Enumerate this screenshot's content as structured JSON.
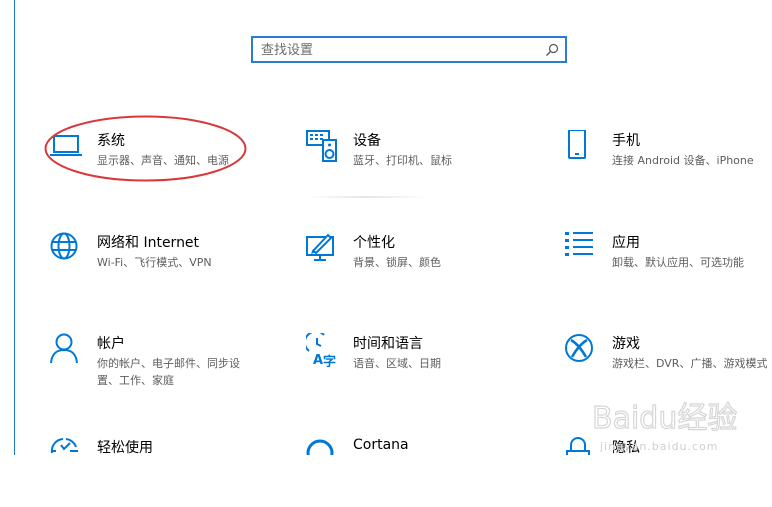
{
  "search": {
    "placeholder": "查找设置"
  },
  "tiles": [
    {
      "title": "系统",
      "desc": "显示器、声音、通知、电源",
      "icon": "laptop-icon"
    },
    {
      "title": "设备",
      "desc": "蓝牙、打印机、鼠标",
      "icon": "keyboard-speaker-icon"
    },
    {
      "title": "手机",
      "desc": "连接 Android 设备、iPhone",
      "icon": "phone-icon"
    },
    {
      "title": "网络和 Internet",
      "desc": "Wi-Fi、飞行模式、VPN",
      "icon": "globe-icon"
    },
    {
      "title": "个性化",
      "desc": "背景、锁屏、颜色",
      "icon": "paint-monitor-icon"
    },
    {
      "title": "应用",
      "desc": "卸载、默认应用、可选功能",
      "icon": "apps-list-icon"
    },
    {
      "title": "帐户",
      "desc": "你的帐户、电子邮件、同步设置、工作、家庭",
      "icon": "person-icon"
    },
    {
      "title": "时间和语言",
      "desc": "语音、区域、日期",
      "icon": "time-language-icon"
    },
    {
      "title": "游戏",
      "desc": "游戏栏、DVR、广播、游戏模式",
      "icon": "xbox-icon"
    },
    {
      "title": "轻松使用",
      "desc": "",
      "icon": "ease-of-access-icon"
    },
    {
      "title": "Cortana",
      "desc": "",
      "icon": "cortana-icon"
    },
    {
      "title": "隐私",
      "desc": "",
      "icon": "lock-icon"
    }
  ],
  "colors": {
    "accent": "#0078d7",
    "annotation": "#d9383a"
  },
  "watermark": {
    "brand": "Baidu经验",
    "url": "jingyan.baidu.com"
  }
}
